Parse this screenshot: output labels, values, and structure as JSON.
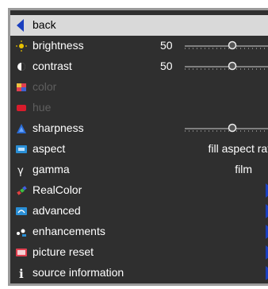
{
  "menu": {
    "back": "back",
    "brightness": {
      "label": "brightness",
      "value": "50",
      "level": 0.5
    },
    "contrast": {
      "label": "contrast",
      "value": "50",
      "level": 0.5
    },
    "color": "color",
    "hue": "hue",
    "sharpness": {
      "label": "sharpness",
      "level": 0.5
    },
    "aspect": {
      "label": "aspect",
      "value": "fill aspect ratio"
    },
    "gamma": {
      "label": "gamma",
      "value": "film"
    },
    "realcolor": "RealColor",
    "advanced": "advanced",
    "enhancements": "enhancements",
    "picture_reset": "picture reset",
    "source_information": "source information"
  },
  "colors": {
    "panel": "#2f2f2f",
    "selected": "#d9d9d9",
    "accent": "#1a3fbf",
    "disabled": "#5f5f5f"
  }
}
